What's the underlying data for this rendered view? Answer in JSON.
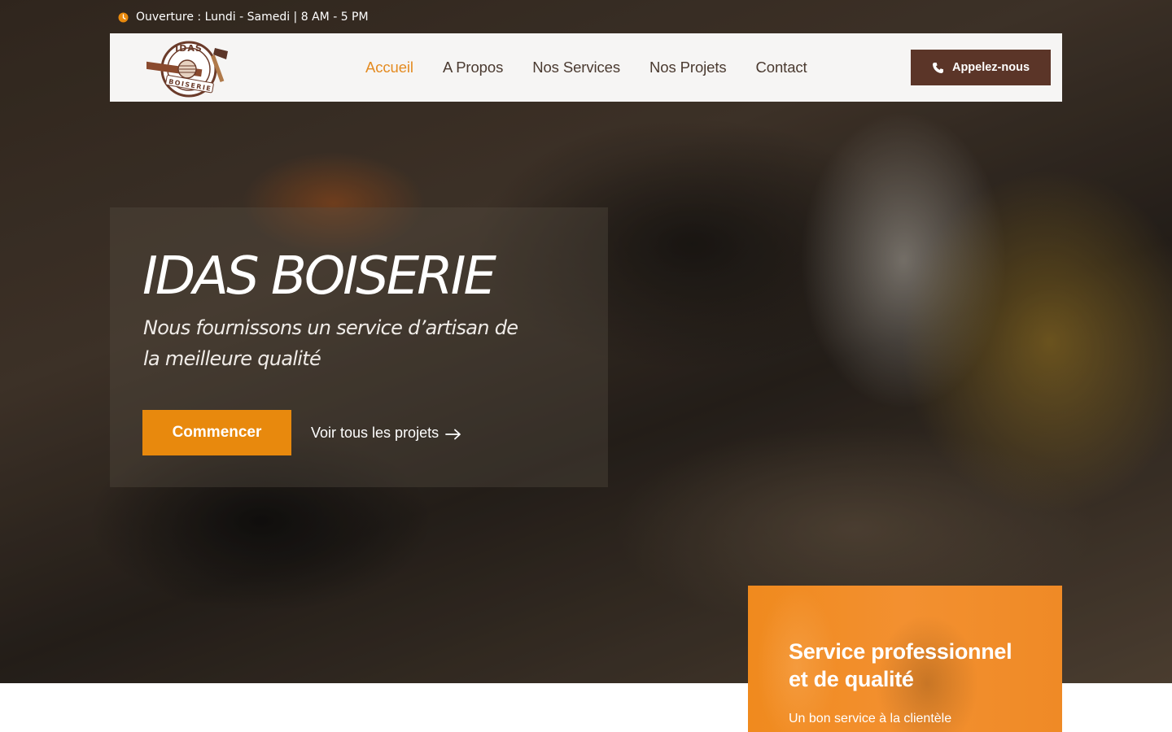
{
  "topbar": {
    "hours": "Ouverture : Lundi - Samedi | 8 AM - 5 PM",
    "icon": "clock-icon"
  },
  "brand": {
    "logo_top_text": "IDAS",
    "logo_bottom_text": "BOISERIE"
  },
  "nav": {
    "items": [
      {
        "label": "Accueil",
        "active": true
      },
      {
        "label": "A Propos",
        "active": false
      },
      {
        "label": "Nos Services",
        "active": false
      },
      {
        "label": "Nos Projets",
        "active": false
      },
      {
        "label": "Contact",
        "active": false
      }
    ],
    "call_label": "Appelez-nous",
    "call_icon": "phone-icon"
  },
  "hero": {
    "title_part1": "IDAS",
    "title_part2": "BOISERIE",
    "subtitle": "Nous fournissons un service d’artisan de la meilleure qualité",
    "primary_button": "Commencer",
    "secondary_link": "Voir tous les projets",
    "secondary_icon": "arrow-right-icon"
  },
  "service_card": {
    "title": "Service professionnel et de qualité",
    "subtitle": "Un bon service à la clientèle"
  },
  "colors": {
    "accent": "#e8890d",
    "brand_dark": "#5b3528",
    "nav_text": "#4a3a30",
    "nav_bg": "#f6f5f4"
  }
}
